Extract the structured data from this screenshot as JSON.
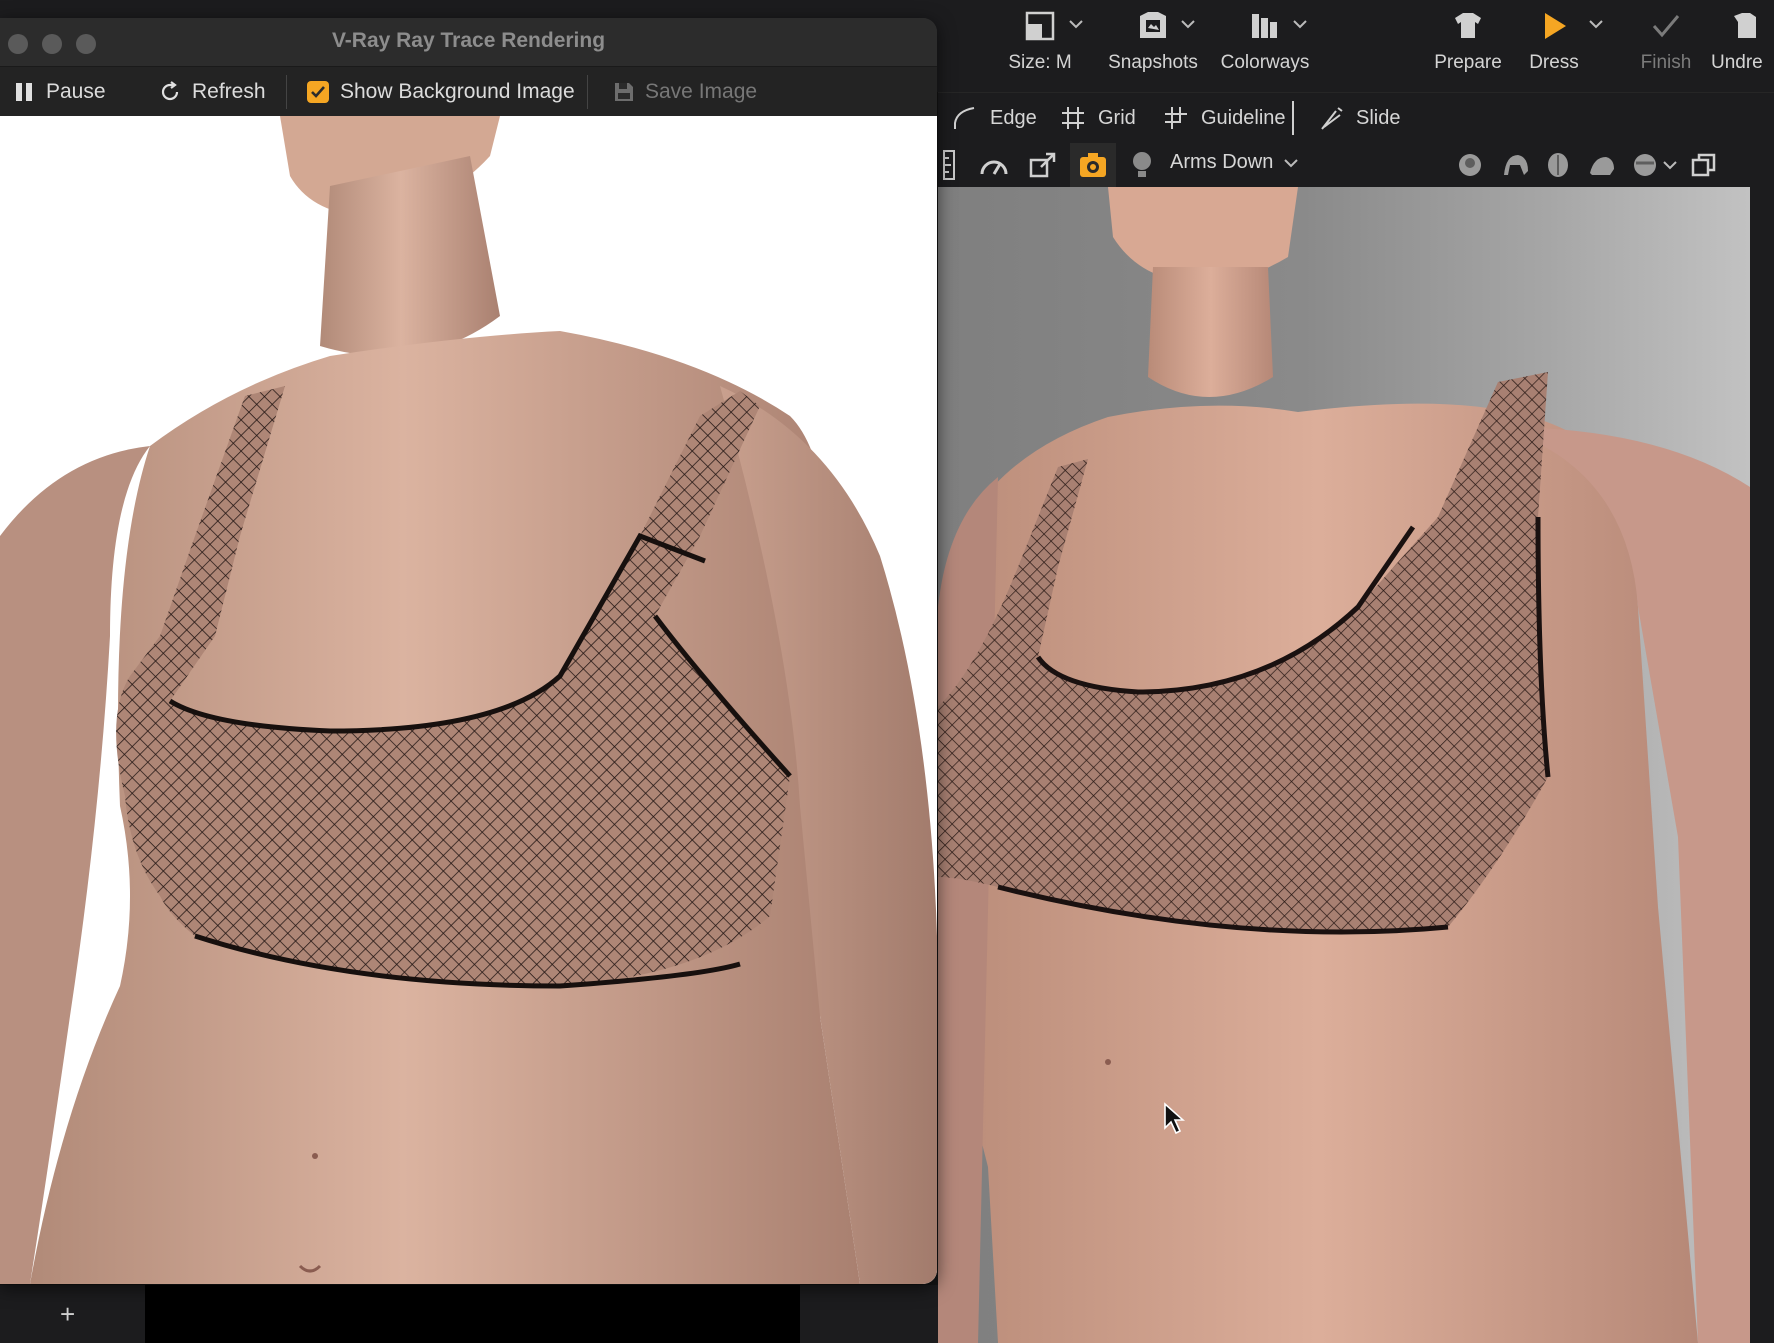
{
  "app": {
    "toolbar": {
      "size_label": "Size: M",
      "snapshots_label": "Snapshots",
      "colorways_label": "Colorways",
      "prepare_label": "Prepare",
      "dress_label": "Dress",
      "finish_label": "Finish",
      "undress_label": "Undre"
    },
    "edit_tools": {
      "edge_label": "Edge",
      "grid_label": "Grid",
      "guideline_label": "Guideline",
      "slide_label": "Slide"
    },
    "view_toolbar": {
      "pose_value": "Arms Down"
    },
    "colors": {
      "accent": "#f5a623",
      "toolbar_bg": "#1c1c1e"
    }
  },
  "vray_window": {
    "title": "V-Ray Ray Trace Rendering",
    "toolbar": {
      "pause_label": "Pause",
      "refresh_label": "Refresh",
      "show_background_label": "Show Background Image",
      "show_background_checked": true,
      "save_image_label": "Save Image"
    }
  },
  "bottom_bar": {
    "add_label": "+"
  }
}
